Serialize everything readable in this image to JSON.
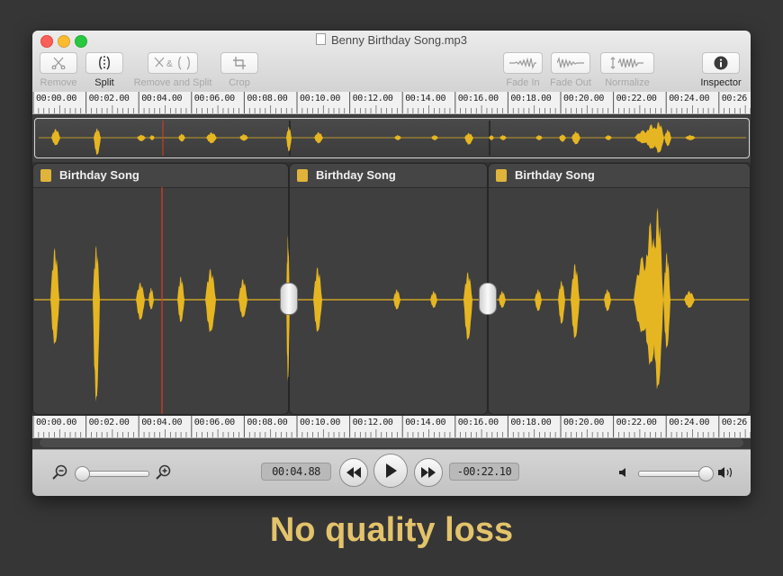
{
  "window": {
    "title": "Benny Birthday Song.mp3"
  },
  "toolbar": {
    "remove_label": "Remove",
    "split_label": "Split",
    "remove_and_split_label": "Remove and Split",
    "crop_label": "Crop",
    "fade_in_label": "Fade In",
    "fade_out_label": "Fade Out",
    "normalize_label": "Normalize",
    "inspector_label": "Inspector"
  },
  "ruler": {
    "labels": [
      "00:00.00",
      "00:02.00",
      "00:04.00",
      "00:06.00",
      "00:08.00",
      "00:10.00",
      "00:12.00",
      "00:14.00",
      "00:16.00",
      "00:18.00",
      "00:20.00",
      "00:22.00",
      "00:24.00",
      "00:26"
    ]
  },
  "clips": [
    {
      "title": "Birthday Song"
    },
    {
      "title": "Birthday Song"
    },
    {
      "title": "Birthday Song"
    }
  ],
  "transport": {
    "current_time": "00:04.88",
    "remaining_time": "-00:22.10"
  },
  "tagline": "No quality loss",
  "colors": {
    "waveform": "#e6b622",
    "playhead": "#e03c1c",
    "tagline": "#e3c36b"
  },
  "icons": [
    "scissors-icon",
    "split-icon",
    "remove-and-split-icon",
    "crop-icon",
    "fade-in-icon",
    "fade-out-icon",
    "normalize-icon",
    "info-icon",
    "zoom-out-icon",
    "zoom-in-icon",
    "rewind-icon",
    "play-icon",
    "fast-forward-icon",
    "volume-low-icon",
    "volume-high-icon"
  ]
}
